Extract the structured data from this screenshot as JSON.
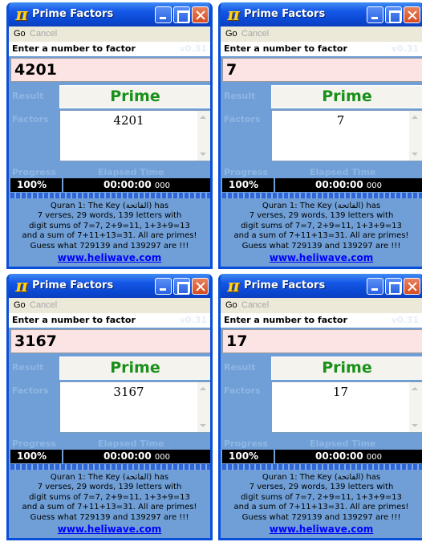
{
  "windows": [
    {
      "title": "Prime Factors",
      "app_icon": "pi-icon",
      "menu": {
        "go": "Go",
        "cancel": "Cancel"
      },
      "prompt": "Enter a number to factor",
      "version": "v0.31",
      "input_value": "4201",
      "result_label": "Result",
      "result": "Prime",
      "factors_label": "Factors",
      "factors": "4201",
      "progress_label": "Progress",
      "elapsed_label": "Elapsed Time",
      "progress": "100%",
      "elapsed": "00:00:00",
      "elapsed_ms": "000",
      "info_lines": [
        "Quran 1: The Key (الفاتحة) has",
        "7 verses, 29 words, 139 letters with",
        "digit sums of 7=7, 2+9=11, 1+3+9=13",
        "and a sum of 7+11+13=31. All are primes!",
        "Guess what 729139 and 139297 are !!!"
      ],
      "link": "www.heliwave.com"
    },
    {
      "title": "Prime Factors",
      "app_icon": "pi-icon",
      "menu": {
        "go": "Go",
        "cancel": "Cancel"
      },
      "prompt": "Enter a number to factor",
      "version": "v0.31",
      "input_value": "7",
      "result_label": "Result",
      "result": "Prime",
      "factors_label": "Factors",
      "factors": "7",
      "progress_label": "Progress",
      "elapsed_label": "Elapsed Time",
      "progress": "100%",
      "elapsed": "00:00:00",
      "elapsed_ms": "000",
      "info_lines": [
        "Quran 1: The Key (الفاتحة) has",
        "7 verses, 29 words, 139 letters with",
        "digit sums of 7=7, 2+9=11, 1+3+9=13",
        "and a sum of 7+11+13=31. All are primes!",
        "Guess what 729139 and 139297 are !!!"
      ],
      "link": "www.heliwave.com"
    },
    {
      "title": "Prime Factors",
      "app_icon": "pi-icon",
      "menu": {
        "go": "Go",
        "cancel": "Cancel"
      },
      "prompt": "Enter a number to factor",
      "version": "v0.31",
      "input_value": "3167",
      "result_label": "Result",
      "result": "Prime",
      "factors_label": "Factors",
      "factors": "3167",
      "progress_label": "Progress",
      "elapsed_label": "Elapsed Time",
      "progress": "100%",
      "elapsed": "00:00:00",
      "elapsed_ms": "000",
      "info_lines": [
        "Quran 1: The Key (الفاتحة) has",
        "7 verses, 29 words, 139 letters with",
        "digit sums of 7=7, 2+9=11, 1+3+9=13",
        "and a sum of 7+11+13=31. All are primes!",
        "Guess what 729139 and 139297 are !!!"
      ],
      "link": "www.heliwave.com"
    },
    {
      "title": "Prime Factors",
      "app_icon": "pi-icon",
      "menu": {
        "go": "Go",
        "cancel": "Cancel"
      },
      "prompt": "Enter a number to factor",
      "version": "v0.31",
      "input_value": "17",
      "result_label": "Result",
      "result": "Prime",
      "factors_label": "Factors",
      "factors": "17",
      "progress_label": "Progress",
      "elapsed_label": "Elapsed Time",
      "progress": "100%",
      "elapsed": "00:00:00",
      "elapsed_ms": "000",
      "info_lines": [
        "Quran 1: The Key (الفاتحة) has",
        "7 verses, 29 words, 139 letters with",
        "digit sums of 7=7, 2+9=11, 1+3+9=13",
        "and a sum of 7+11+13=31. All are primes!",
        "Guess what 729139 and 139297 are !!!"
      ],
      "link": "www.heliwave.com"
    }
  ],
  "colors": {
    "title_bar": "#0a48d2",
    "window_body": "#6f9fd6",
    "result_text": "#199019",
    "input_background": "#fde4e4",
    "link": "#0000ff"
  }
}
